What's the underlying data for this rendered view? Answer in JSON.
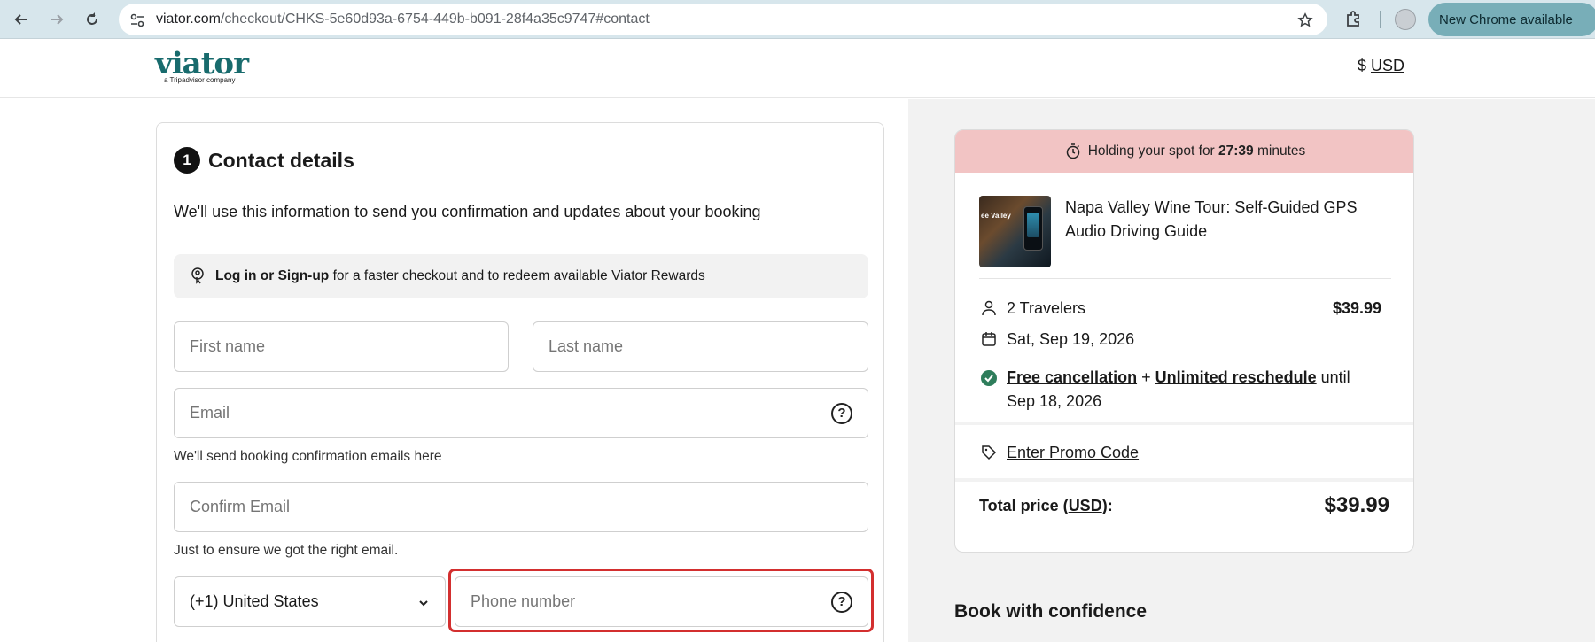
{
  "browser": {
    "url_host": "viator.com",
    "url_path": "/checkout/CHKS-5e60d93a-6754-449b-b091-28f4a35c9747#contact",
    "update_label": "New Chrome available"
  },
  "header": {
    "logo_text": "viator",
    "logo_sub": "a Tripadvisor company",
    "currency_symbol": "$",
    "currency_code": "USD"
  },
  "contact": {
    "step_number": "1",
    "title": "Contact details",
    "description": "We'll use this information to send you confirmation and updates about your booking",
    "login_strong": "Log in or Sign-up",
    "login_rest": " for a faster checkout and to redeem available Viator Rewards",
    "first_name_placeholder": "First name",
    "last_name_placeholder": "Last name",
    "email_placeholder": "Email",
    "email_hint": "We'll send booking confirmation emails here",
    "confirm_email_placeholder": "Confirm Email",
    "confirm_hint": "Just to ensure we got the right email.",
    "country_code": "(+1) United States",
    "phone_placeholder": "Phone number"
  },
  "summary": {
    "hold_prefix": "Holding your spot for ",
    "hold_time": "27:39",
    "hold_suffix": " minutes",
    "thumb_caption": "ee Valley",
    "tour_title": "Napa Valley Wine Tour: Self-Guided GPS Audio Driving Guide",
    "travelers": "2 Travelers",
    "price": "$39.99",
    "date": "Sat, Sep 19, 2026",
    "free_cancellation": "Free cancellation",
    "plus": " + ",
    "unlimited_reschedule": "Unlimited reschedule",
    "until": " until Sep 18, 2026",
    "promo": "Enter Promo Code",
    "total_prefix": "Total price (",
    "total_currency": "USD",
    "total_suffix": "):",
    "total_value": "$39.99"
  },
  "confidence_title": "Book with confidence",
  "colors": {
    "brand": "#186b6d",
    "hold_bar": "#f2c4c4",
    "highlight": "#d32f2f",
    "check": "#2e7d5b"
  }
}
